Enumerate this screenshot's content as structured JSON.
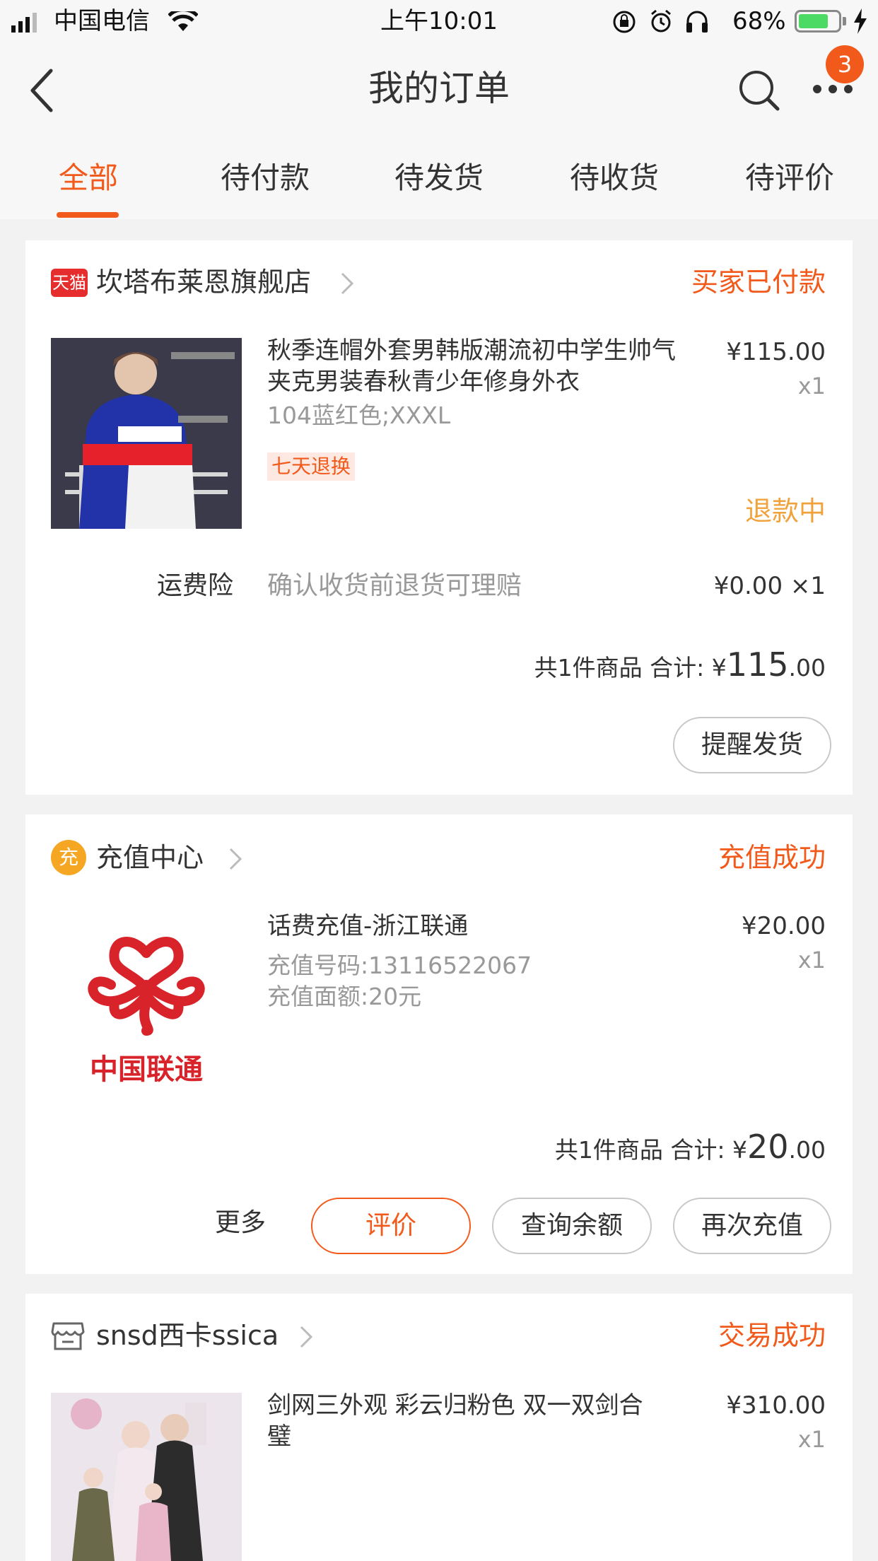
{
  "status_bar": {
    "carrier": "中国电信",
    "time": "上午10:01",
    "battery_percent": "68%",
    "battery_level": 0.68
  },
  "nav": {
    "title": "我的订单",
    "badge_count": "3"
  },
  "tabs": [
    {
      "label": "全部",
      "active": true
    },
    {
      "label": "待付款",
      "active": false
    },
    {
      "label": "待发货",
      "active": false
    },
    {
      "label": "待收货",
      "active": false
    },
    {
      "label": "待评价",
      "active": false
    }
  ],
  "orders": [
    {
      "shop_badge": "天猫",
      "shop_name": "坎塔布莱恩旗舰店",
      "status": "买家已付款",
      "title": "秋季连帽外套男韩版潮流初中学生帅气夹克男装春秋青少年修身外衣",
      "sku": "104蓝红色;XXXL",
      "tag": "七天退换",
      "price": "¥115.00",
      "qty": "x1",
      "refund_status": "退款中",
      "insurance_label": "运费险",
      "insurance_desc": "确认收货前退货可理赔",
      "insurance_price": "¥0.00 ×1",
      "total_prefix": "共1件商品 合计: ¥",
      "total_int": "115",
      "total_dec": ".00",
      "buttons": [
        "提醒发货"
      ]
    },
    {
      "shop_badge": "充",
      "shop_name": "充值中心",
      "status": "充值成功",
      "title": "话费充值-浙江联通",
      "line1": "充值号码:13116522067",
      "line2": "充值面额:20元",
      "logo_text": "中国联通",
      "price": "¥20.00",
      "qty": "x1",
      "total_prefix": "共1件商品 合计: ¥",
      "total_int": "20",
      "total_dec": ".00",
      "more": "更多",
      "buttons": [
        "评价",
        "查询余额",
        "再次充值"
      ]
    },
    {
      "shop_name": "snsd西卡ssica",
      "status": "交易成功",
      "title": "剑网三外观 彩云归粉色 双一双剑合璧",
      "price": "¥310.00",
      "qty": "x1"
    }
  ],
  "colors": {
    "accent": "#f25a1c",
    "refund": "#f0a23c",
    "tmall": "#e52d2d",
    "unicom": "#d8232a"
  }
}
